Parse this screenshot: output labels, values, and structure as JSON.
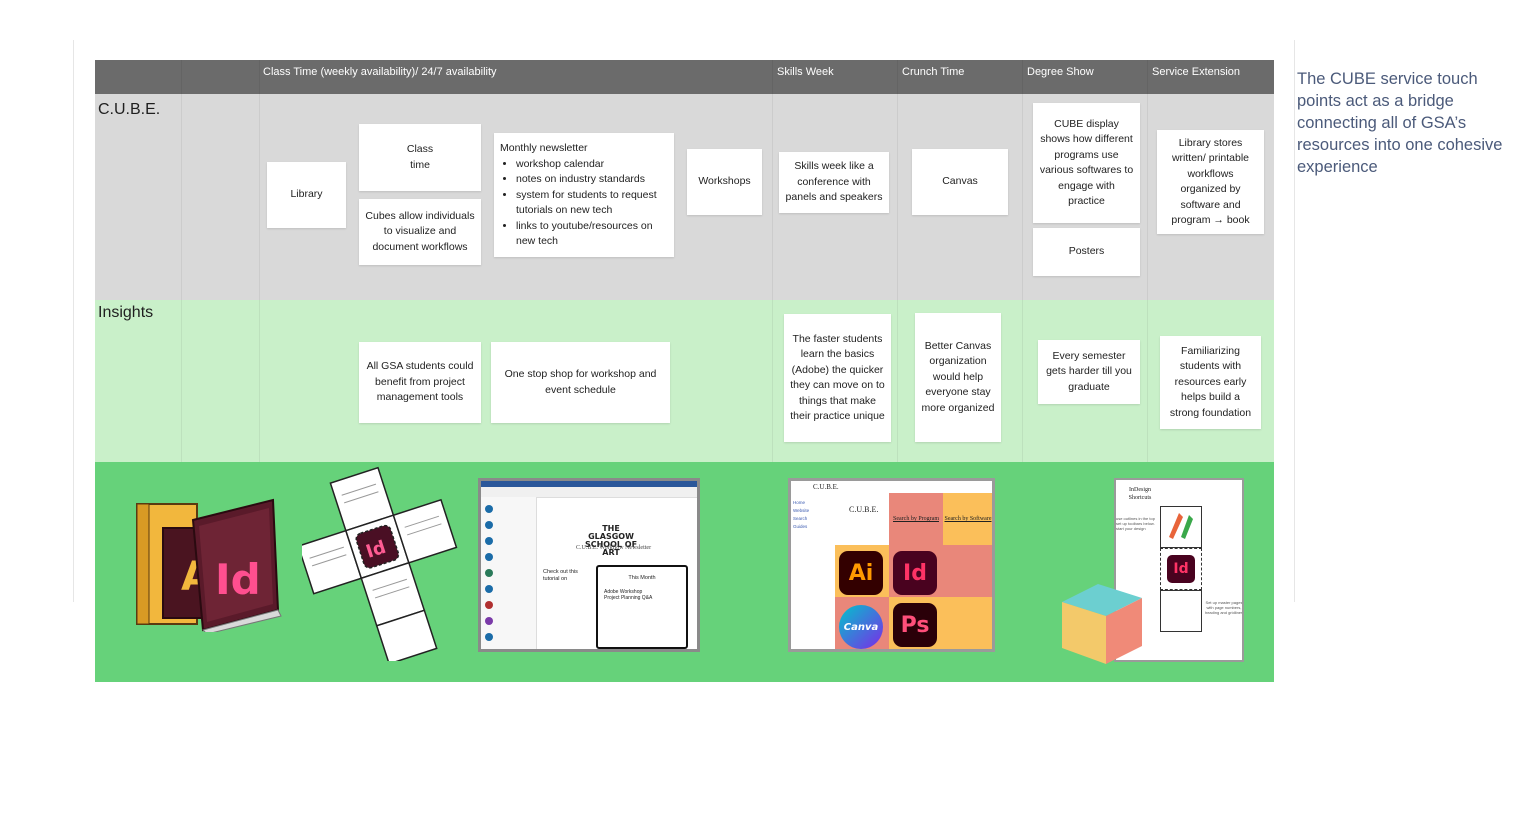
{
  "headers": {
    "class_time": "Class Time (weekly availability)/ 24/7 availability",
    "skills_week": "Skills Week",
    "crunch_time": "Crunch Time",
    "degree_show": "Degree Show",
    "service_extension": "Service Extension"
  },
  "rows": {
    "cube": "C.U.B.E.",
    "insights": "Insights"
  },
  "cube_notes": {
    "library": "Library",
    "class_time": "Class time",
    "cubes_allow": "Cubes allow individuals to visualize and document workflows",
    "newsletter_title": "Monthly newsletter",
    "newsletter_items": [
      "workshop calendar",
      "notes on industry standards",
      "system for students to request tutorials on new tech",
      "links to youtube/resources on new tech"
    ],
    "workshops": "Workshops",
    "skills_week": "Skills week like a conference with panels and speakers",
    "canvas": "Canvas",
    "cube_display": "CUBE display shows how different programs use various softwares to engage with practice",
    "posters": "Posters",
    "library_stores": "Library stores written/ printable workflows organized by software and program → book"
  },
  "insight_notes": {
    "pm_tools": "All GSA students could benefit from project management tools",
    "one_stop": "One stop shop for workshop and event schedule",
    "faster_students": "The faster students learn the basics (Adobe) the quicker they can move on to things that make their practice unique",
    "better_canvas": "Better Canvas organization would help everyone stay more organized",
    "every_semester": "Every semester gets harder till you graduate",
    "familiarizing": "Familiarizing students with resources early helps build a strong foundation"
  },
  "side_text": "The CUBE service touch points act as a bridge connecting all of GSA’s resources into one cohesive experience",
  "newsletter_shot": {
    "school": "THE GLASGOW SCHOOL OF ART",
    "title": "C.U.B.E. Workflow Newsletter",
    "check_out": "Check out this tutorial on",
    "this_month": "This Month",
    "items": [
      "Adobe Workshop",
      "Project Planning Q&A"
    ]
  },
  "website_shot": {
    "logo": "C.U.B.E.",
    "heading": "C.U.B.E.",
    "search_program": "Search by Program",
    "search_software": "Search by Software",
    "nav": [
      "Home",
      "Website",
      "Search",
      "Guides"
    ]
  },
  "shortcuts_shot": {
    "title": "InDesign Shortcuts",
    "left_text": "use outlines in the top set up toolbars below. start your design",
    "right_text": "Set up master pages with page numbers, heading and gridlines"
  },
  "icons": {
    "ai": "Ai",
    "id": "Id",
    "ps": "Ps",
    "canva": "Canva"
  },
  "colors": {
    "header": "#6b6b6b",
    "cube_band": "#d9d9d9",
    "insight_band": "#c9f0c9",
    "image_band": "#66d27a",
    "side_text": "#4b5a7a"
  }
}
